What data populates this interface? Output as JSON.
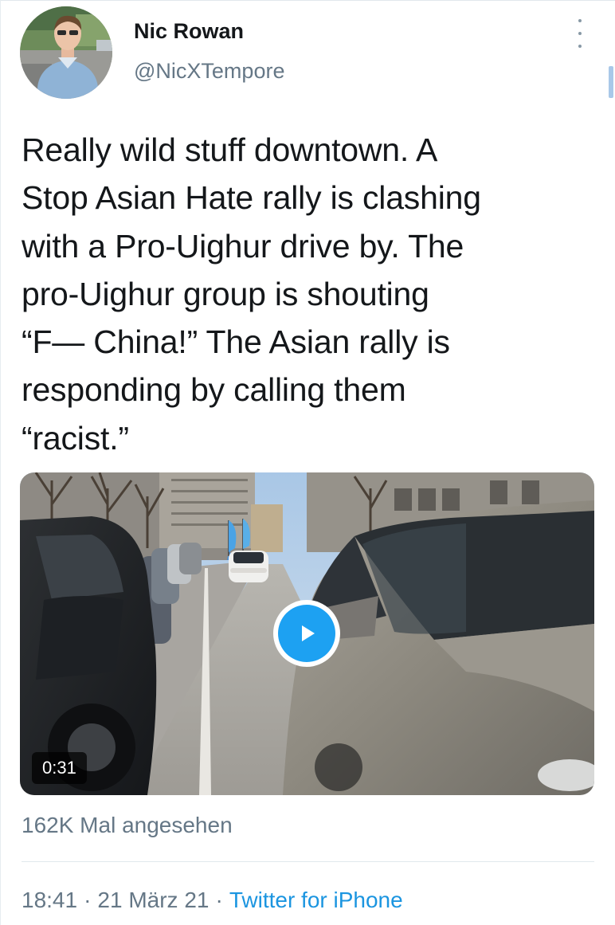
{
  "author": {
    "display_name": "Nic Rowan",
    "handle": "@NicXTempore"
  },
  "tweet": {
    "text": "Really wild stuff downtown. A\nStop Asian Hate rally is clashing\nwith a Pro-Uighur drive by. The\npro-Uighur group is shouting\n“F— China!” The Asian rally is\nresponding by calling them\n“racist.”"
  },
  "media": {
    "type": "video",
    "duration": "0:31"
  },
  "stats": {
    "views": "162K Mal angesehen"
  },
  "meta": {
    "time": "18:41",
    "date": "21 März 21",
    "separator": "·",
    "source": "Twitter for iPhone"
  },
  "colors": {
    "accent": "#1da1f2",
    "link": "#1b95e0",
    "secondary_text": "#657786",
    "primary_text": "#14171a"
  },
  "icons": {
    "more": "more-vertical-icon",
    "play": "play-icon"
  }
}
